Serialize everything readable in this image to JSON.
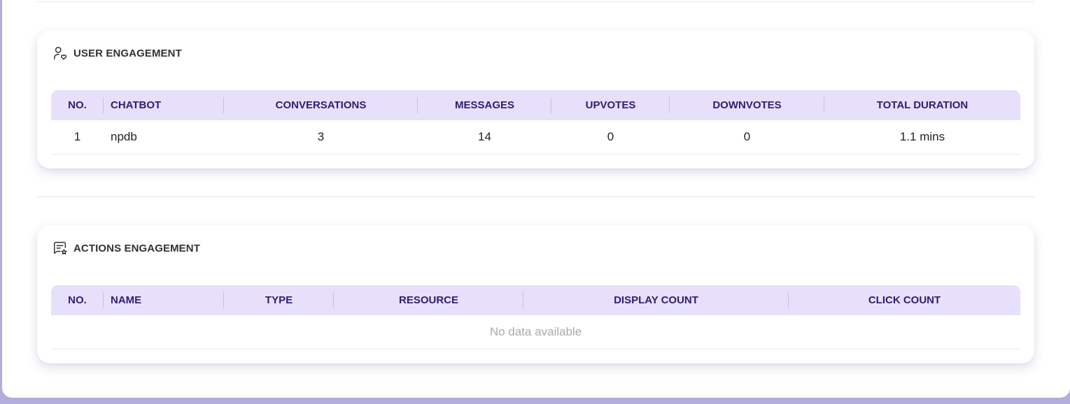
{
  "user_engagement": {
    "title": "USER ENGAGEMENT",
    "icon": "user-heart-icon",
    "columns": [
      "NO.",
      "CHATBOT",
      "CONVERSATIONS",
      "MESSAGES",
      "UPVOTES",
      "DOWNVOTES",
      "TOTAL DURATION"
    ],
    "rows": [
      [
        "1",
        "npdb",
        "3",
        "14",
        "0",
        "0",
        "1.1 mins"
      ]
    ]
  },
  "actions_engagement": {
    "title": "ACTIONS ENGAGEMENT",
    "icon": "message-star-icon",
    "columns": [
      "NO.",
      "NAME",
      "TYPE",
      "RESOURCE",
      "DISPLAY COUNT",
      "CLICK COUNT"
    ],
    "empty_text": "No data available"
  },
  "colors": {
    "background": "#b3addb",
    "header_bg": "#e6e0fb",
    "header_text": "#2d1f70"
  }
}
